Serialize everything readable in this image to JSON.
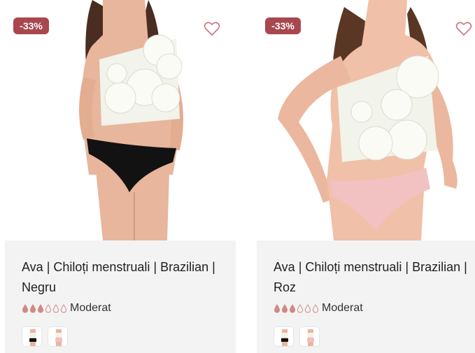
{
  "products": [
    {
      "discount": "-33%",
      "title": "Ava | Chiloți menstruali | Brazilian | Negru",
      "rating_label": "Moderat",
      "rating_level": 3,
      "rating_max": 6,
      "image_alt": "Model wearing white flower top and black brazilian menstrual briefs",
      "brief_color": "#121212",
      "colors": {
        "badge": "#a9474f",
        "drop_filled": "#d08a86",
        "drop_empty": "#d08a86"
      }
    },
    {
      "discount": "-33%",
      "title": "Ava | Chiloți menstruali | Brazilian | Roz",
      "rating_label": "Moderat",
      "rating_level": 3,
      "rating_max": 6,
      "image_alt": "Model wearing white flower top and pink brazilian menstrual briefs",
      "brief_color": "#f2c1c1",
      "colors": {
        "badge": "#a9474f",
        "drop_filled": "#d08a86",
        "drop_empty": "#d08a86"
      }
    }
  ],
  "icons": {
    "wishlist": "heart-outline-icon",
    "absorbency": "drop-icon"
  }
}
